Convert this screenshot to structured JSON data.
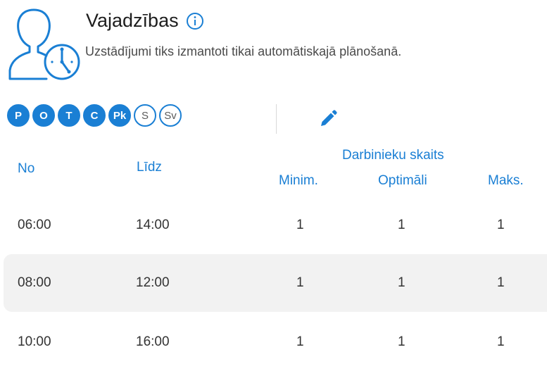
{
  "header": {
    "title": "Vajadzības",
    "subtitle": "Uzstādījumi tiks izmantoti tikai automātiskajā plānošanā."
  },
  "days": [
    {
      "label": "P",
      "active": true
    },
    {
      "label": "O",
      "active": true
    },
    {
      "label": "T",
      "active": true
    },
    {
      "label": "C",
      "active": true
    },
    {
      "label": "Pk",
      "active": true
    },
    {
      "label": "S",
      "active": false
    },
    {
      "label": "Sv",
      "active": false
    }
  ],
  "table": {
    "col_from": "No",
    "col_to": "Līdz",
    "group_label": "Darbinieku skaits",
    "col_min": "Minim.",
    "col_opt": "Optimāli",
    "col_max": "Maks.",
    "rows": [
      {
        "from": "06:00",
        "to": "14:00",
        "min": "1",
        "opt": "1",
        "max": "1"
      },
      {
        "from": "08:00",
        "to": "12:00",
        "min": "1",
        "opt": "1",
        "max": "1"
      },
      {
        "from": "10:00",
        "to": "16:00",
        "min": "1",
        "opt": "1",
        "max": "1"
      }
    ]
  },
  "colors": {
    "accent": "#1a7fd4",
    "row_alt": "#f2f2f2"
  },
  "icons": [
    "person-clock-icon",
    "info-icon",
    "pencil-icon"
  ]
}
